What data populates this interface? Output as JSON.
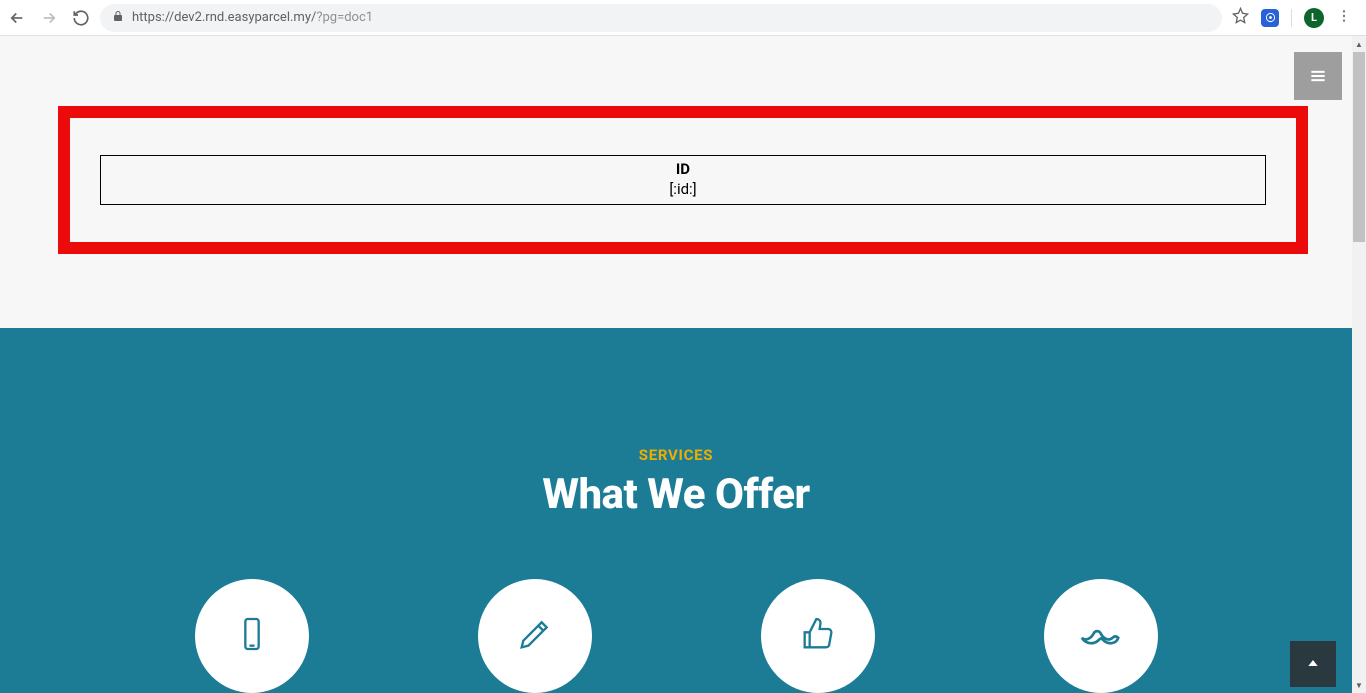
{
  "browser": {
    "url_host": "https://dev2.rnd.easyparcel.my/",
    "url_query": "?pg=doc1",
    "profile_letter": "L"
  },
  "highlight": {
    "header": "ID",
    "value": "[:id:]"
  },
  "services": {
    "label": "SERVICES",
    "heading": "What We Offer"
  }
}
